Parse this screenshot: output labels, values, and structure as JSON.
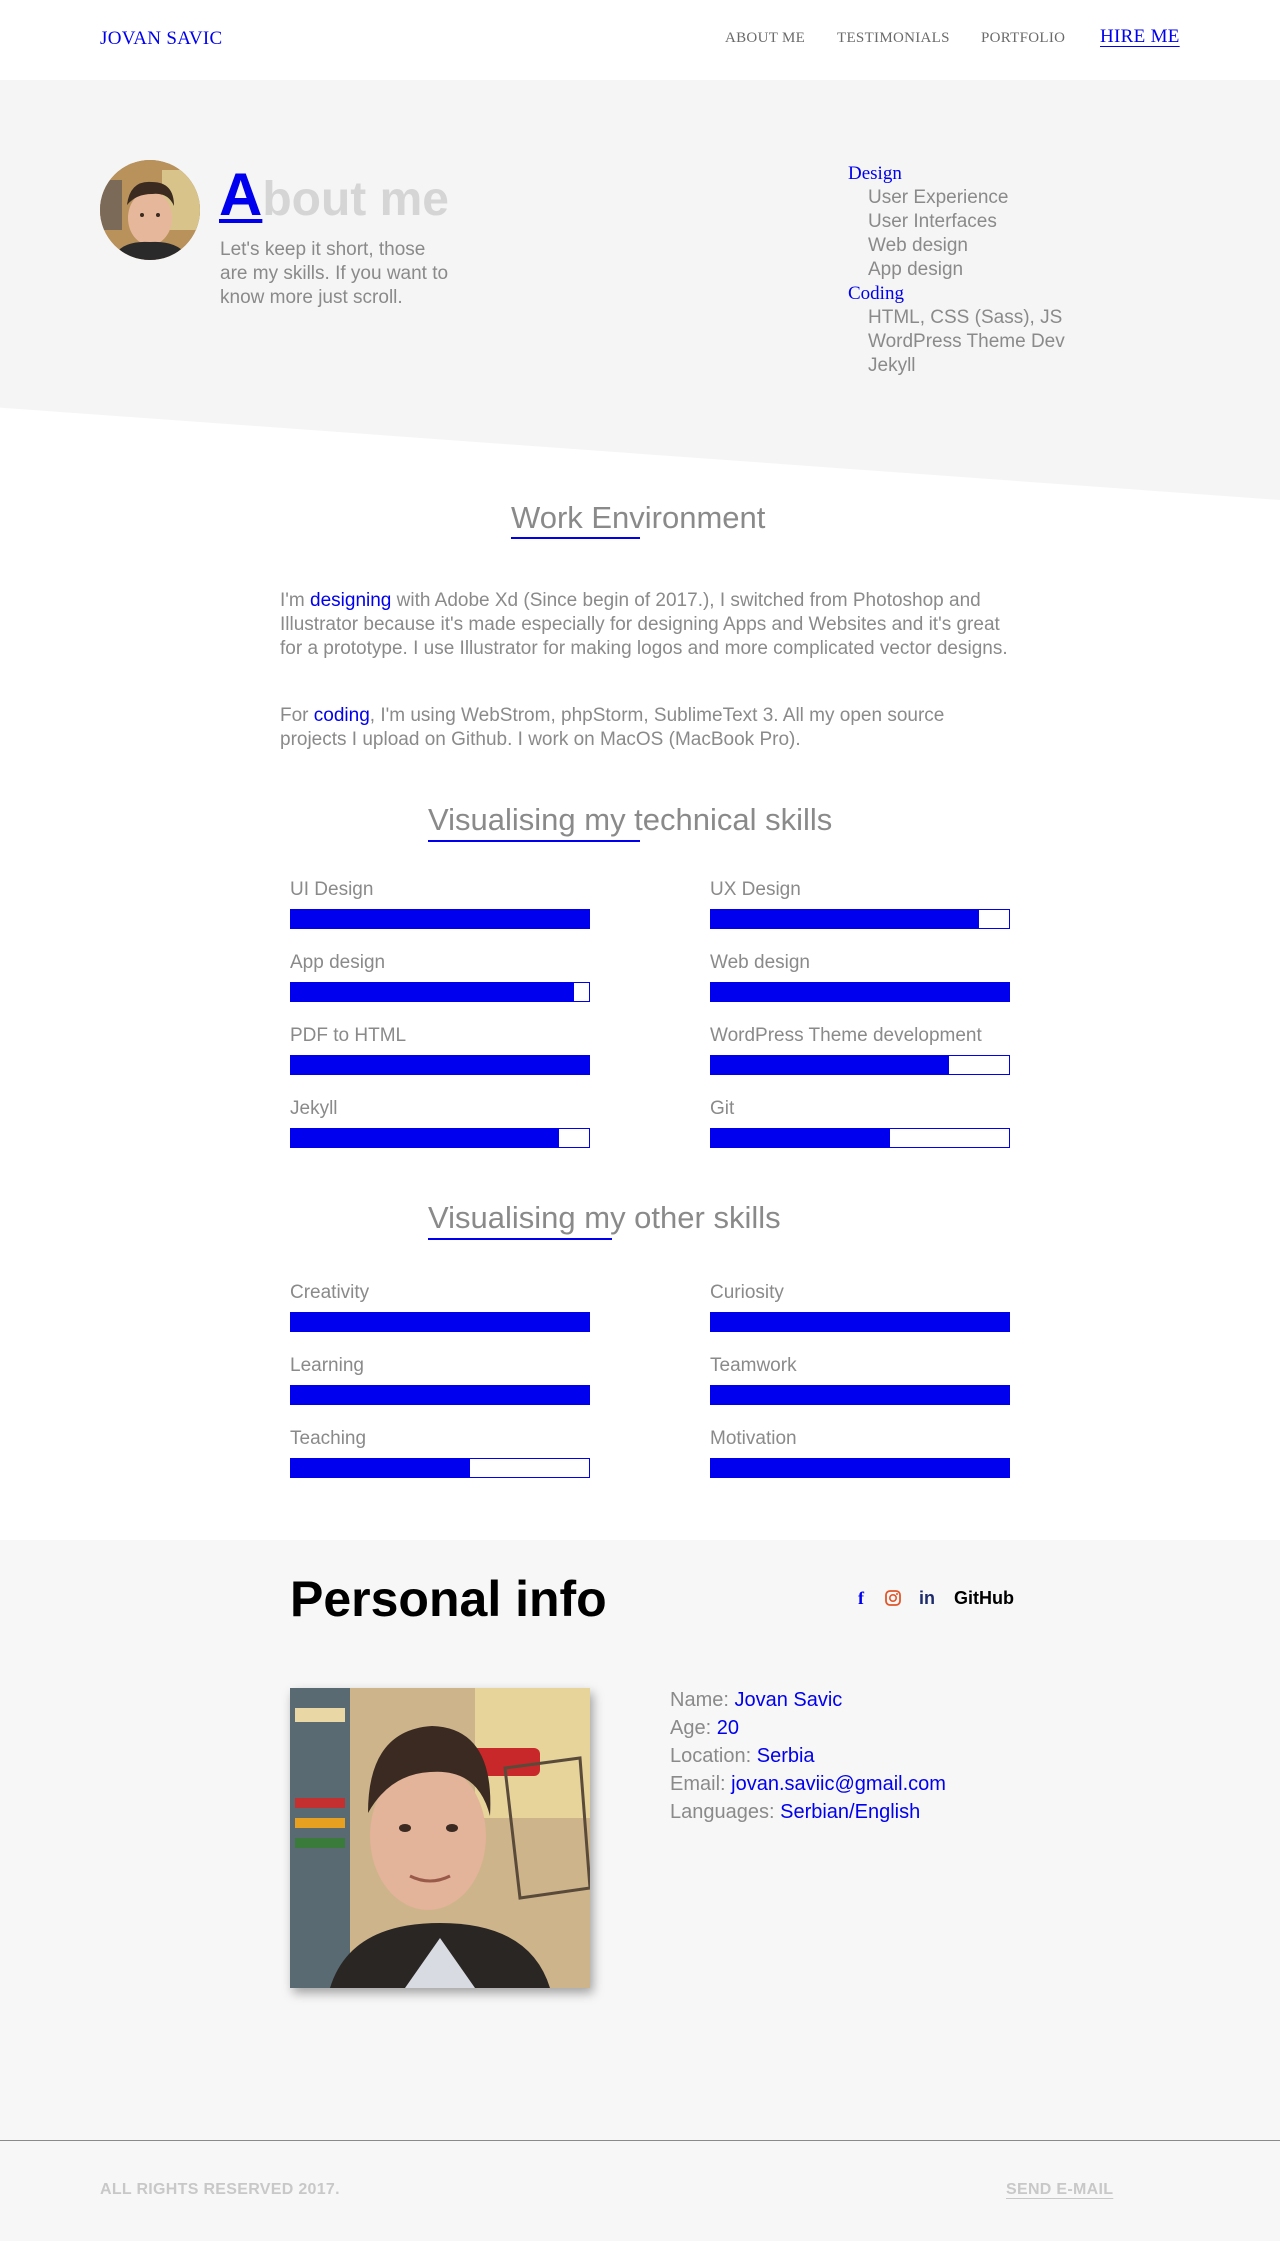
{
  "header": {
    "brand": "JOVAN SAVIC",
    "nav": [
      "ABOUT ME",
      "TESTIMONIALS",
      "PORTFOLIO"
    ],
    "hire": "HIRE ME"
  },
  "hero": {
    "title_first": "A",
    "title_rest": "bout me",
    "description": "Let's keep it short, those are my skills. If you want to know more just scroll.",
    "skill_groups": [
      {
        "category": "Design",
        "items": [
          "User Experience",
          "User Interfaces",
          "Web design",
          "App design"
        ]
      },
      {
        "category": "Coding",
        "items": [
          "HTML, CSS (Sass), JS",
          "WordPress Theme Dev",
          "Jekyll"
        ]
      }
    ]
  },
  "work": {
    "title": "Work Environment",
    "p1_pre": "I'm ",
    "p1_link": "designing",
    "p1_post": " with Adobe Xd (Since begin of 2017.), I switched from Photoshop and Illustrator because it's made especially for designing Apps and Websites and it's great for a prototype. I use Illustrator for making logos and more complicated vector designs.",
    "p2_pre": "For ",
    "p2_link": "coding",
    "p2_post": ", I'm using WebStrom, phpStorm, SublimeText 3. All my open source projects I upload on Github. I work on MacOS (MacBook Pro)."
  },
  "technical": {
    "title": "Visualising my technical skills",
    "skills": [
      {
        "label": "UI Design",
        "level": 1.0
      },
      {
        "label": "UX Design",
        "level": 0.9
      },
      {
        "label": "App design",
        "level": 0.95
      },
      {
        "label": "Web design",
        "level": 1.0
      },
      {
        "label": "PDF to HTML",
        "level": 1.0
      },
      {
        "label": "WordPress Theme development",
        "level": 0.8
      },
      {
        "label": "Jekyll",
        "level": 0.9
      },
      {
        "label": "Git",
        "level": 0.6
      }
    ]
  },
  "other": {
    "title": "Visualising my other skills",
    "skills": [
      {
        "label": "Creativity",
        "level": 1.0
      },
      {
        "label": "Curiosity",
        "level": 1.0
      },
      {
        "label": "Learning",
        "level": 1.0
      },
      {
        "label": "Teamwork",
        "level": 1.0
      },
      {
        "label": "Teaching",
        "level": 0.6
      },
      {
        "label": "Motivation",
        "level": 1.0
      }
    ]
  },
  "personal": {
    "title": "Personal info",
    "socials": {
      "facebook": "f",
      "linkedin": "in",
      "github": "GitHub"
    },
    "info": [
      {
        "key": "Name: ",
        "value": "Jovan Savic"
      },
      {
        "key": "Age: ",
        "value": "20"
      },
      {
        "key": "Location: ",
        "value": "Serbia"
      },
      {
        "key": "Email: ",
        "value": "jovan.saviic@gmail.com"
      },
      {
        "key": "Languages: ",
        "value": "Serbian/English"
      }
    ]
  },
  "footer": {
    "rights": "ALL RIGHTS RESERVED 2017.",
    "send": "SEND E-MAIL"
  },
  "colors": {
    "accent": "#0000ee",
    "text": "#8a8a8a",
    "muted": "#d5d5d5",
    "section_bg": "#f7f7f7"
  }
}
